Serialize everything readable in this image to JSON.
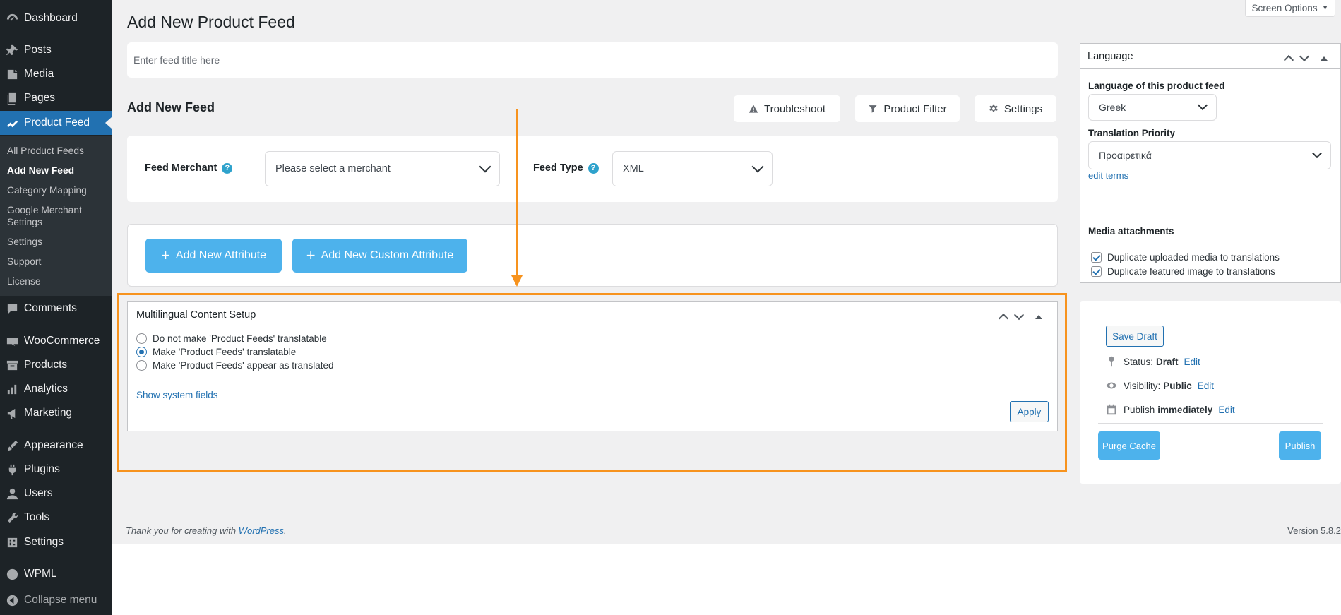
{
  "sidebar": {
    "menu": [
      {
        "label": "Dashboard",
        "icon": "dashboard-icon"
      },
      {
        "label": "Posts",
        "icon": "pin-icon"
      },
      {
        "label": "Media",
        "icon": "media-icon"
      },
      {
        "label": "Pages",
        "icon": "pages-icon"
      },
      {
        "label": "Product Feed",
        "icon": "chart-icon"
      },
      {
        "label": "Comments",
        "icon": "comment-icon"
      },
      {
        "label": "WooCommerce",
        "icon": "woo-icon"
      },
      {
        "label": "Products",
        "icon": "archive-icon"
      },
      {
        "label": "Analytics",
        "icon": "bar-chart-icon"
      },
      {
        "label": "Marketing",
        "icon": "megaphone-icon"
      },
      {
        "label": "Appearance",
        "icon": "brush-icon"
      },
      {
        "label": "Plugins",
        "icon": "plug-icon"
      },
      {
        "label": "Users",
        "icon": "user-icon"
      },
      {
        "label": "Tools",
        "icon": "wrench-icon"
      },
      {
        "label": "Settings",
        "icon": "sliders-icon"
      },
      {
        "label": "WPML",
        "icon": "wpml-icon"
      }
    ],
    "submenu": [
      "All Product Feeds",
      "Add New Feed",
      "Category Mapping",
      "Google Merchant",
      "Settings",
      "Settings",
      "Support",
      "License"
    ],
    "collapse_label": "Collapse menu"
  },
  "header": {
    "title": "Add New Product Feed",
    "screen_options": "Screen Options"
  },
  "feed_title": {
    "placeholder": "Enter feed title here"
  },
  "feed_section": {
    "heading": "Add New Feed",
    "buttons": {
      "troubleshoot": "Troubleshoot",
      "product_filter": "Product Filter",
      "settings": "Settings"
    },
    "merchant_label": "Feed Merchant",
    "merchant_value": "Please select a merchant",
    "type_label": "Feed Type",
    "type_value": "XML",
    "help_glyph": "?"
  },
  "attributes": {
    "add_attribute": "Add New Attribute",
    "add_custom_attribute": "Add New Custom Attribute",
    "plus": "+"
  },
  "multilingual": {
    "title": "Multilingual Content Setup",
    "options": [
      {
        "label": "Do not make 'Product Feeds' translatable",
        "selected": false
      },
      {
        "label": "Make 'Product Feeds' translatable",
        "selected": true
      },
      {
        "label": "Make 'Product Feeds' appear as translated",
        "selected": false
      }
    ],
    "show_fields": "Show system fields",
    "apply": "Apply"
  },
  "language_box": {
    "title": "Language",
    "language_label": "Language of this product feed",
    "language_value": "Greek",
    "priority_label": "Translation Priority",
    "priority_value": "Προαιρετικά",
    "edit_terms": "edit terms",
    "media_label": "Media attachments",
    "media_options": [
      "Duplicate uploaded media to translations",
      "Duplicate featured image to translations"
    ]
  },
  "publish_box": {
    "save_draft": "Save Draft",
    "status_label": "Status:",
    "status_value": "Draft",
    "visibility_label": "Visibility:",
    "visibility_value": "Public",
    "publish_label": "Publish",
    "publish_value": "immediately",
    "edit": "Edit",
    "purge_cache": "Purge Cache",
    "publish": "Publish"
  },
  "footer": {
    "thanks_prefix": "Thank you for creating with",
    "wordpress": "WordPress",
    "thanks_suffix": ".",
    "version": "Version 5.8.2"
  },
  "colors": {
    "accent": "#2271b1",
    "highlight": "#f7931e",
    "button_blue": "#4db2ec",
    "sidebar": "#1d2327"
  }
}
